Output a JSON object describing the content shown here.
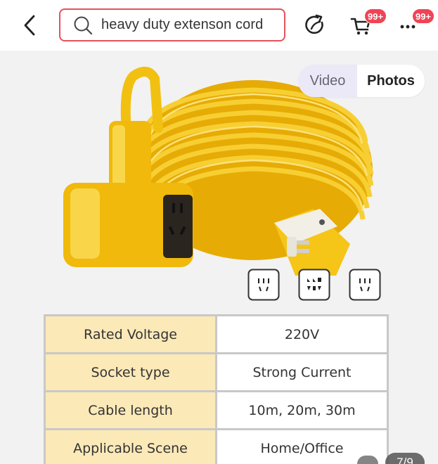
{
  "header": {
    "search_query": "heavy duty extenson cord",
    "cart_badge": "99+",
    "more_badge": "99+",
    "accent_color": "#e8505b"
  },
  "gallery": {
    "toggle": {
      "video_label": "Video",
      "photos_label": "Photos",
      "selected": "Photos"
    },
    "product_color": "#f5c518",
    "socket_icons": [
      "two-pin-socket-icon",
      "four-pin-socket-icon",
      "two-pin-socket-icon"
    ],
    "image_counter": "7/9"
  },
  "specs": {
    "rows": [
      {
        "label": "Rated Voltage",
        "value": "220V"
      },
      {
        "label": "Socket type",
        "value": "Strong Current"
      },
      {
        "label": "Cable length",
        "value": "10m, 20m, 30m"
      },
      {
        "label": "Applicable Scene",
        "value": "Home/Office"
      }
    ]
  }
}
